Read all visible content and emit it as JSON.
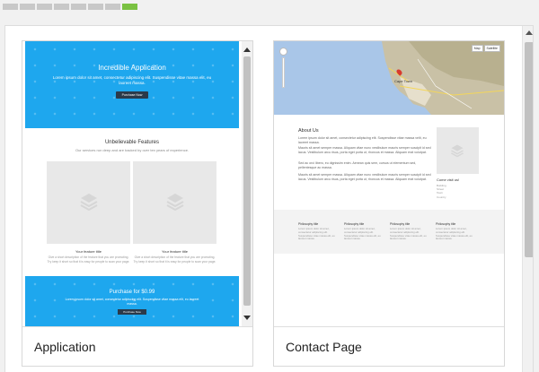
{
  "steps": {
    "count": 8,
    "active_index": 7
  },
  "cards": [
    {
      "title": "Application",
      "preview": {
        "hero": {
          "title": "Incredible Application",
          "text": "Lorem ipsum dolor sit amet, consectetur adipiscing elit. Suspendisse vitae massa elit, eu laoreet massa.",
          "button": "Purchase Now"
        },
        "features": {
          "title": "Unbelievable Features",
          "subtitle": "Our services run deep and are backed by over ten years of experience.",
          "items": [
            {
              "name": "Your feature title",
              "desc": "Give a short description of the feature that you are promoting. Try keep it short so that it is easy for people to scan your page."
            },
            {
              "name": "Your feature title",
              "desc": "Give a short description of the feature that you are promoting. Try keep it short so that it is easy for people to scan your page."
            }
          ]
        },
        "promo": {
          "title": "Purchase for $0.99",
          "text": "Lorem ipsum dolor sit amet, consectetur adipiscing elit. Suspendisse vitae massa elit, eu laoreet massa.",
          "button": "Purchase Now"
        }
      }
    },
    {
      "title": "Contact Page",
      "preview": {
        "map": {
          "type_buttons": [
            "Map",
            "Satellite"
          ],
          "city_label": "Cape Town"
        },
        "about": {
          "title": "About Us",
          "paragraphs": [
            "Lorem ipsum dolor sit amet, consectetur adipiscing elit. Suspendisse vitae massa velit, eu laoreet massa.",
            "Mauris sit amet semper massa. Aliquam vitae nunc vestibulum mauris semper suscipit id sed lacus. Vestibulum arcu risus, porta eget porta ut, rhoncus et massa. Aliquam erat volutpat.",
            "Sed ac orci libero, eu dignissim enim. Aenean quis sem, cursus ut elementum sed, pellentesque ac massa.",
            "Mauris sit amet semper massa. Aliquam vitae nunc vestibulum mauris semper suscipit id sed lacus. Vestibulum arcu risus, porta eget porta ut, rhoncus et massa. Aliquam erat volutpat."
          ]
        },
        "visit": {
          "title": "Come visit us!",
          "lines": [
            "Building",
            "Street",
            "Town",
            "Country"
          ]
        },
        "philosophy": [
          {
            "title": "Philosophy title",
            "text": "Lorem ipsum dolor sit amet, consectetur adipiscing elit. Suspendisse vitae massa elit, eu laoreet massa."
          },
          {
            "title": "Philosophy title",
            "text": "Lorem ipsum dolor sit amet, consectetur adipiscing elit. Suspendisse vitae massa elit, eu laoreet massa."
          },
          {
            "title": "Philosophy title",
            "text": "Lorem ipsum dolor sit amet, consectetur adipiscing elit. Suspendisse vitae massa elit, eu laoreet massa."
          },
          {
            "title": "Philosophy title",
            "text": "Lorem ipsum dolor sit amet, consectetur adipiscing elit. Suspendisse vitae massa elit, eu laoreet massa."
          }
        ]
      }
    }
  ],
  "colors": {
    "accent_blue": "#1ea7ee",
    "step_active": "#7ac142",
    "button_dark": "#2b3a4a"
  },
  "icons": {
    "placeholder": "layers-icon"
  }
}
